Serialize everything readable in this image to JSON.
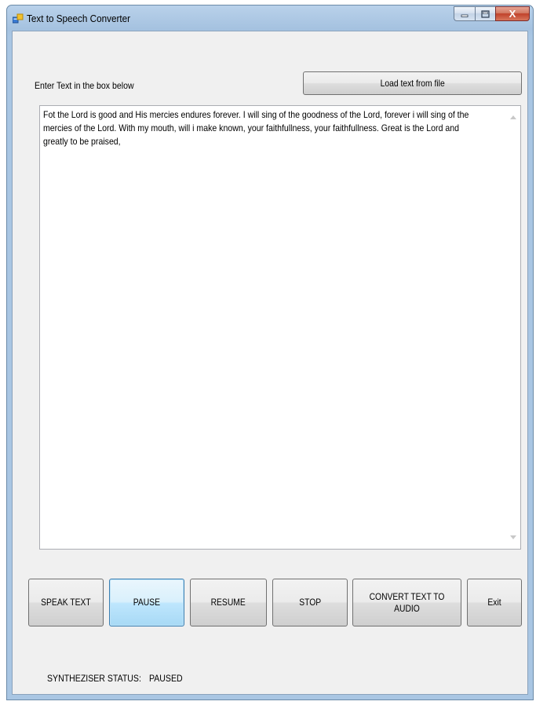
{
  "window": {
    "title": "Text to Speech Converter",
    "close_glyph": "X"
  },
  "main": {
    "prompt_label": "Enter Text in the box below",
    "load_button_label": "Load text from file",
    "text_value": "Fot the Lord is good and His mercies endures forever. I will sing of the goodness of the Lord, forever i will sing of the mercies of the Lord. With my mouth, will i make known, your faithfullness, your faithfullness. Great is the Lord and greatly to be praised,"
  },
  "buttons": {
    "speak": "SPEAK TEXT",
    "pause": "PAUSE",
    "resume": "RESUME",
    "stop": "STOP",
    "convert": "CONVERT TEXT TO AUDIO",
    "exit": "Exit"
  },
  "status": {
    "label": "SYNTHEZISER  STATUS:",
    "value": "PAUSED"
  },
  "icons": {
    "app": "app-icon",
    "minimize": "minimize-icon",
    "maximize": "maximize-icon",
    "close": "close-icon",
    "scroll_up": "scroll-up-icon",
    "scroll_down": "scroll-down-icon"
  },
  "colors": {
    "title_bar": "#b9d1ea",
    "close_button": "#c0412a",
    "focused_button": "#3c7fb1",
    "form_background": "#f0f0f0"
  }
}
